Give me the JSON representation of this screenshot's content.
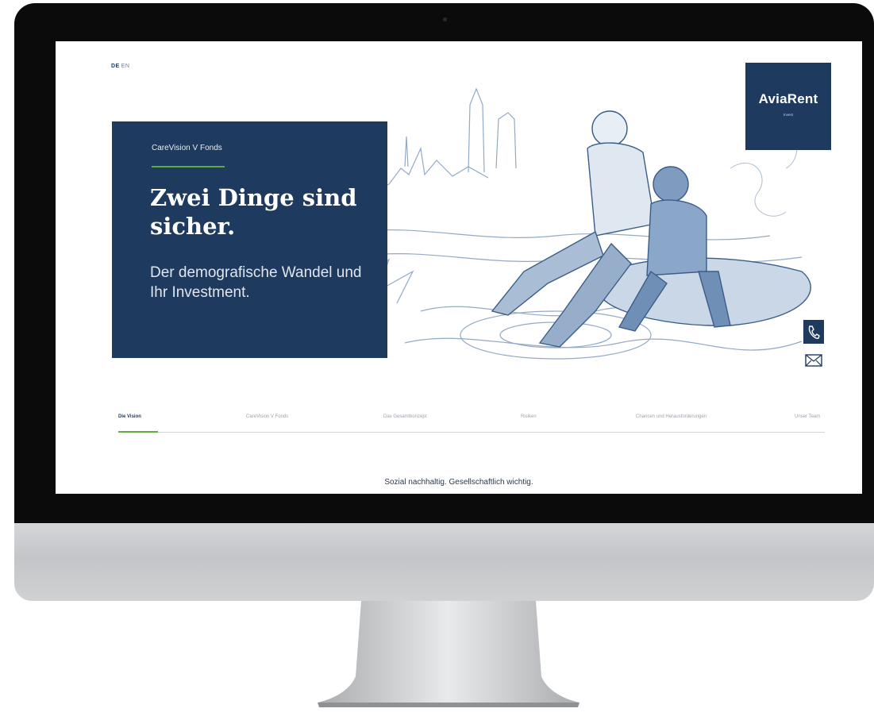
{
  "language_switch": {
    "active": "DE",
    "inactive": "EN"
  },
  "hero": {
    "eyebrow": "CareVision V Fonds",
    "headline": "Zwei Dinge sind sicher.",
    "subline": "Der demografische Wandel und Ihr Investment."
  },
  "logo": {
    "name": "AviaRent",
    "sub": "Invest"
  },
  "contact": {
    "phone_icon": "phone-icon",
    "mail_icon": "mail-icon"
  },
  "nav": {
    "items": [
      {
        "label": "Die Vision",
        "active": true
      },
      {
        "label": "CareVision V Fonds",
        "active": false
      },
      {
        "label": "Das Gesamtkonzept",
        "active": false
      },
      {
        "label": "Risiken",
        "active": false
      },
      {
        "label": "Chancen und Herausforderungen",
        "active": false
      },
      {
        "label": "Unser Team",
        "active": false
      }
    ]
  },
  "section_tagline": "Sozial nachhaltig. Gesellschaftlich wichtig.",
  "colors": {
    "navy": "#1e3a5f",
    "accent_green": "#5fae3d"
  }
}
